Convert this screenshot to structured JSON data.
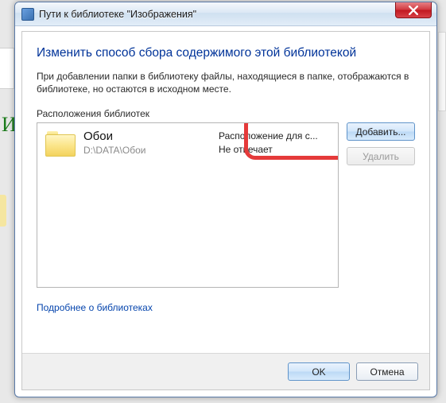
{
  "titlebar": {
    "title": "Пути к библиотеке \"Изображения\""
  },
  "heading": "Изменить способ сбора содержимого этой библиотекой",
  "description": "При добавлении папки в библиотеку файлы, находящиеся в папке, отображаются в библиотеке, но остаются в исходном месте.",
  "list_label": "Расположения библиотек",
  "items": [
    {
      "name": "Обои",
      "path": "D:\\DATA\\Обои",
      "status_line1": "Расположение для с...",
      "status_line2": "Не отвечает"
    }
  ],
  "buttons": {
    "add": "Добавить...",
    "remove": "Удалить",
    "ok": "OK",
    "cancel": "Отмена"
  },
  "link": "Подробнее о библиотеках",
  "bg_letter": "И"
}
